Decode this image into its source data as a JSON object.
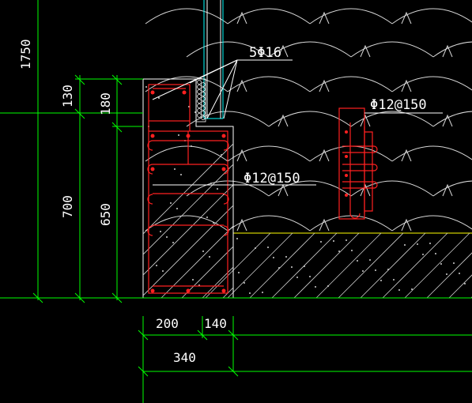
{
  "colors": {
    "background": "#000000",
    "dimension": "#00ff00",
    "text": "#ffffff",
    "rebar": "#ff0000",
    "concrete": "#cccccc",
    "ground_line": "#ffff00",
    "wall_cyan": "#00ffff",
    "leader": "#ffffff"
  },
  "annotations": {
    "top_bars": "5Φ16",
    "stirrup_mid": "Φ12@150",
    "stirrup_side": "Φ12@150"
  },
  "dimensions": {
    "left_total": "1750",
    "left_upper": "130",
    "left_lower": "700",
    "right_upper": "180",
    "right_lower": "650",
    "bottom_left": "200",
    "bottom_right": "140",
    "bottom_total": "340"
  },
  "icons": {
    "earth_fill": "scallop-soil-hatch",
    "concrete_fill": "diagonal-hatch-with-aggregate"
  }
}
